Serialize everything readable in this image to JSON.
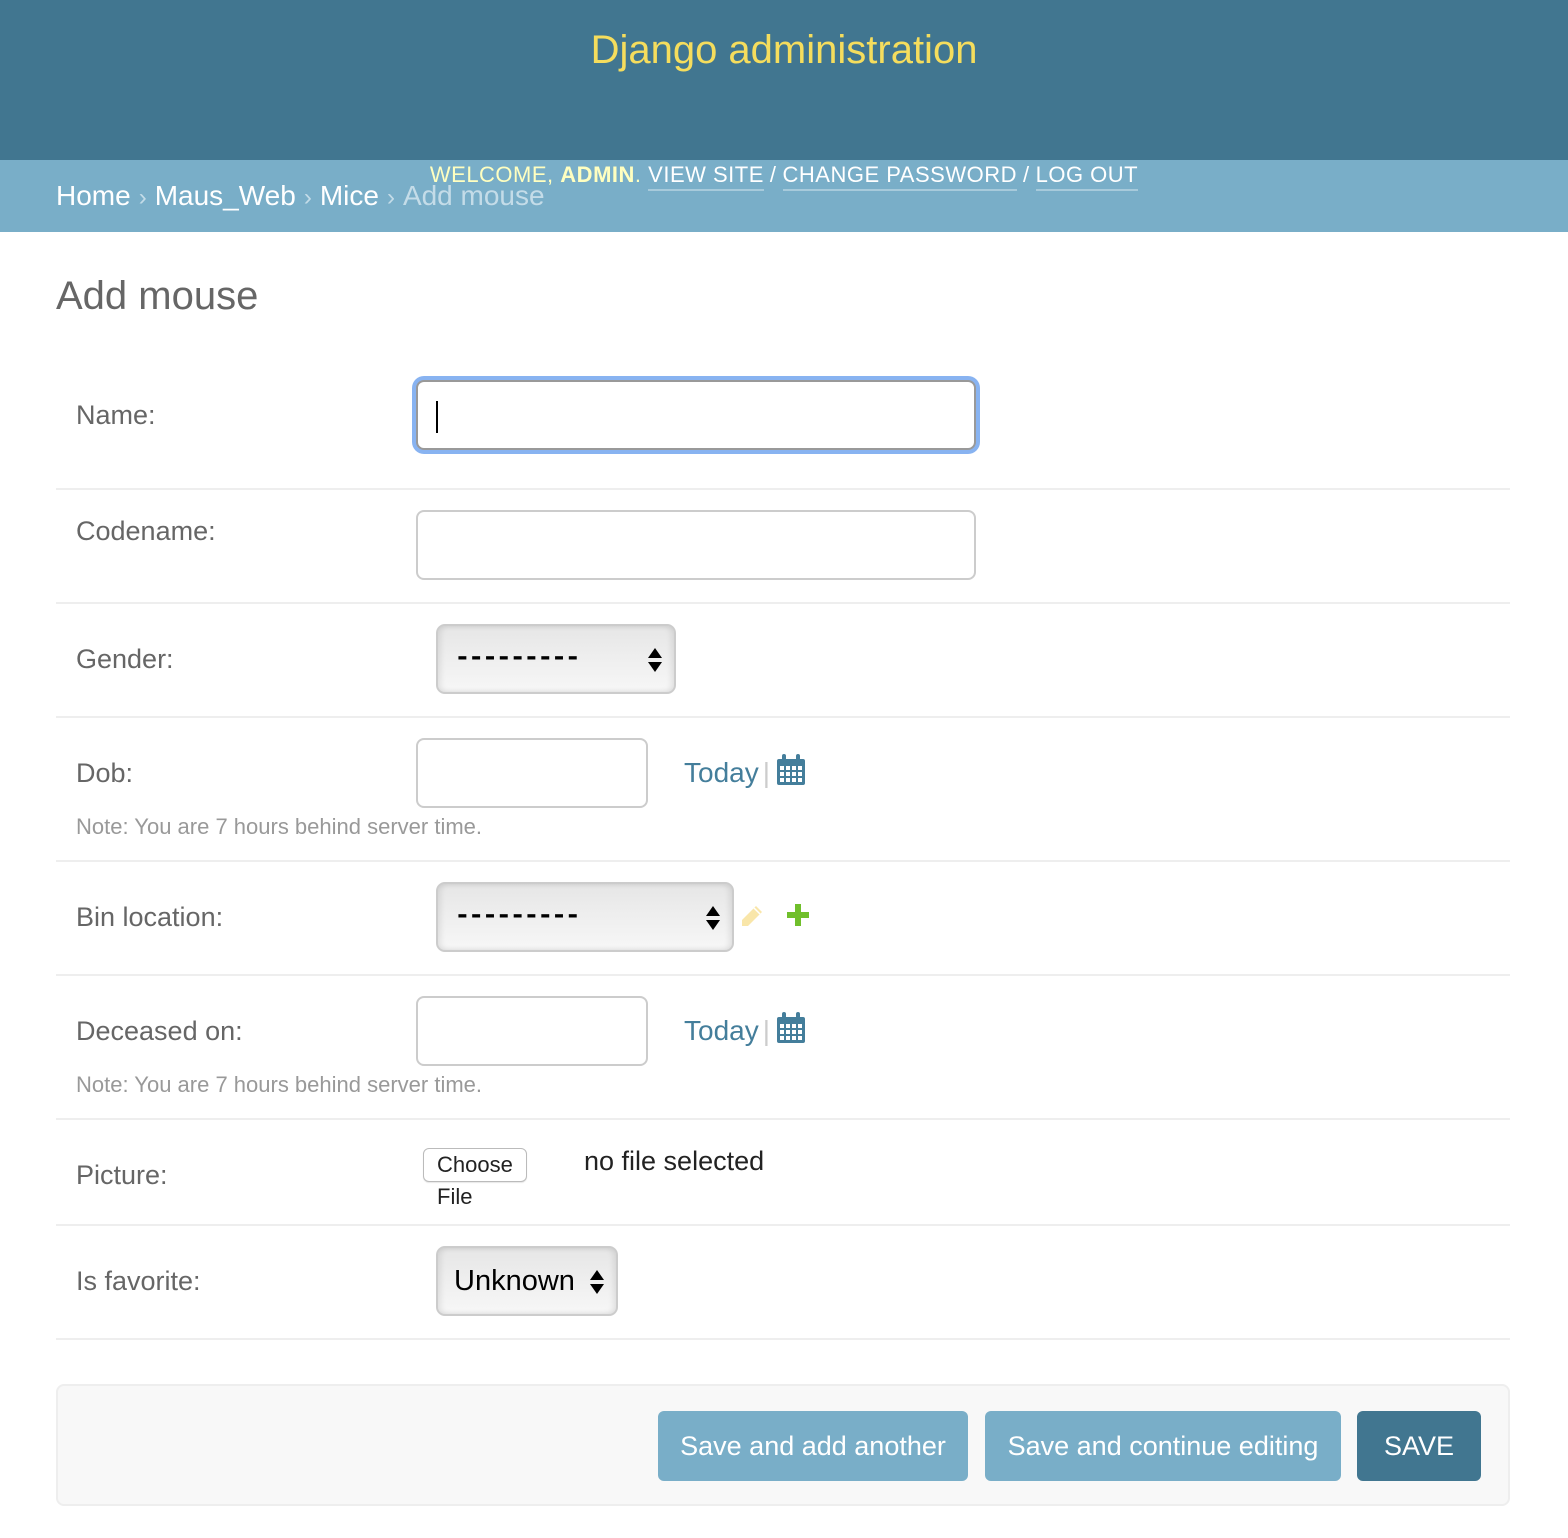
{
  "header": {
    "site_title": "Django administration",
    "welcome_prefix": "Welcome,",
    "username": "admin",
    "welcome_suffix": ".",
    "links": [
      {
        "label": "View site"
      },
      {
        "label": "Change password"
      },
      {
        "label": "Log out"
      }
    ],
    "separator": "/"
  },
  "breadcrumbs": {
    "items": [
      "Home",
      "Maus_Web",
      "Mice"
    ],
    "current": "Add mouse",
    "separator": "›"
  },
  "page_title": "Add mouse",
  "form": {
    "name": {
      "label": "Name:",
      "value": ""
    },
    "codename": {
      "label": "Codename:",
      "value": ""
    },
    "gender": {
      "label": "Gender:",
      "selected": "---------"
    },
    "dob": {
      "label": "Dob:",
      "value": "",
      "today_label": "Today",
      "note": "Note: You are 7 hours behind server time."
    },
    "bin_location": {
      "label": "Bin location:",
      "selected": "---------"
    },
    "deceased_on": {
      "label": "Deceased on:",
      "value": "",
      "today_label": "Today",
      "note": "Note: You are 7 hours behind server time."
    },
    "picture": {
      "label": "Picture:",
      "button_label": "Choose File",
      "status": "no file selected"
    },
    "is_favorite": {
      "label": "Is favorite:",
      "selected": "Unknown"
    }
  },
  "submit": {
    "save_add_another": "Save and add another",
    "save_continue": "Save and continue editing",
    "save": "Save"
  },
  "colors": {
    "header_bg": "#417690",
    "breadcrumb_bg": "#79aec8",
    "site_title": "#f5dd5d",
    "link": "#447e9b",
    "add_icon": "#70bf2b",
    "edit_icon": "#efb80b"
  }
}
